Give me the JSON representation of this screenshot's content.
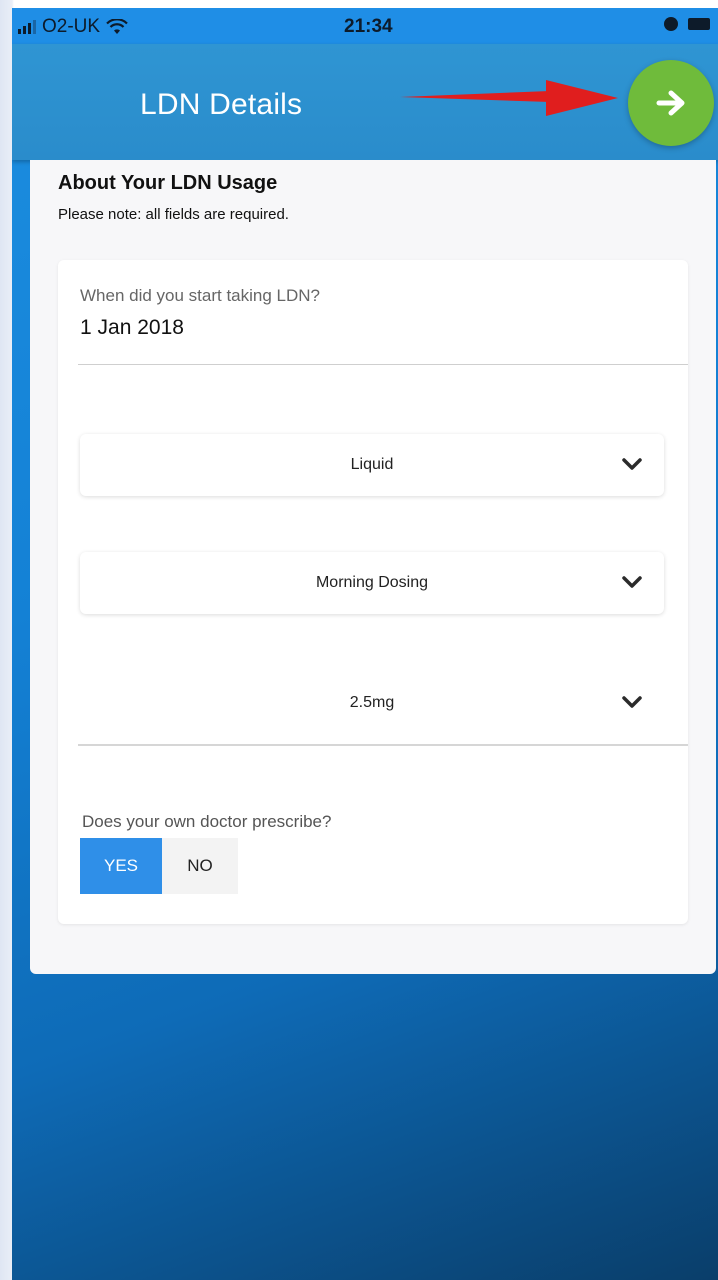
{
  "status_bar": {
    "carrier": "O2-UK",
    "time": "21:34"
  },
  "header": {
    "title": "LDN Details",
    "next_icon": "arrow-right-icon",
    "next_button_color": "#6fbb3b"
  },
  "section": {
    "title": "About Your LDN Usage",
    "note": "Please note: all fields are required."
  },
  "start_date": {
    "label": "When did you start taking LDN?",
    "value": "1 Jan 2018"
  },
  "selects": {
    "form": "Liquid",
    "dosing_time": "Morning Dosing",
    "dose": "2.5mg"
  },
  "doctor_prescribe": {
    "question": "Does your own doctor prescribe?",
    "yes_label": "YES",
    "no_label": "NO",
    "selected": "YES",
    "selected_color": "#2f8fe8"
  },
  "annotation": {
    "arrow_color": "#e01e1e"
  }
}
